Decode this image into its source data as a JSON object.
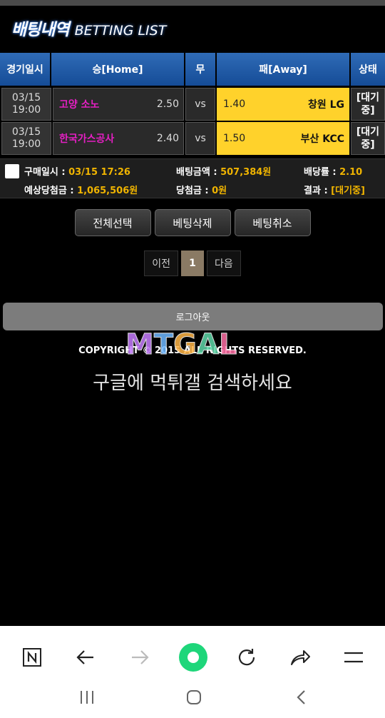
{
  "title": {
    "ko": "배팅내역",
    "en": "BETTING LIST"
  },
  "headers": [
    "경기일시",
    "승[Home]",
    "무",
    "패[Away]",
    "상태"
  ],
  "rows": [
    {
      "date": "03/15",
      "time": "19:00",
      "home": "고양 소노",
      "home_odds": "2.50",
      "vs": "vs",
      "away_odds": "1.40",
      "away": "창원 LG",
      "status_1": "[대기",
      "status_2": "중]"
    },
    {
      "date": "03/15",
      "time": "19:00",
      "home": "한국가스공사",
      "home_odds": "2.40",
      "vs": "vs",
      "away_odds": "1.50",
      "away": "부산 KCC",
      "status_1": "[대기",
      "status_2": "중]"
    }
  ],
  "summary": {
    "purchase_label": "구매일시 : ",
    "purchase_value": "03/15 17:26",
    "amount_label": "배팅금액 : ",
    "amount_value": "507,384원",
    "rate_label": "배당률 : ",
    "rate_value": "2.10",
    "expected_label": "예상당첨금 : ",
    "expected_value": "1,065,506원",
    "win_label": "당첨금 : ",
    "win_value": "0원",
    "result_label": "결과 : ",
    "result_value": "[대기중]"
  },
  "buttons": {
    "select_all": "전체선택",
    "delete": "베팅삭제",
    "cancel": "베팅취소"
  },
  "pager": {
    "prev": "이전",
    "current": "1",
    "next": "다음"
  },
  "logout": "로그아웃",
  "copyright": "COPYRIGHT © 2015 ALL RIGHTS RESERVED.",
  "watermark": "MTGAL",
  "search_tip": "구글에 먹튀갤 검색하세요",
  "colors": {
    "header_blue": "#1f5aa6",
    "away_yellow": "#ffd22b",
    "home_team": "#e61fc4",
    "summary_value": "#f0b400",
    "browser_accent": "#1ed67a"
  },
  "nav_icons": [
    "naver-icon",
    "back-icon",
    "forward-icon",
    "home-circle-icon",
    "reload-icon",
    "share-icon",
    "menu-icon"
  ],
  "system_icons": [
    "recent-apps-icon",
    "home-icon",
    "back-nav-icon"
  ]
}
